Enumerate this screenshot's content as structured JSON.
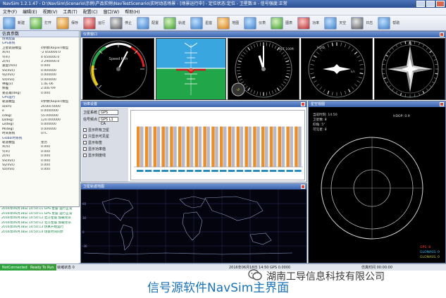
{
  "window": {
    "title": "NavSim 1.2.1.47 - D:\\NavSim\\Scenario\\示例\\产品实例\\NavTestScenario\\实时动态场景 - [场景运行中] - 定位状态:定位 - 卫星数:8 - 信号强度:正常",
    "controls": [
      "minimize-icon",
      "maximize-icon",
      "close-icon"
    ]
  },
  "menu": {
    "items": [
      "文件(F)",
      "编辑(E)",
      "视图(V)",
      "工具(T)",
      "配置(C)",
      "窗口(W)",
      "帮助(H)"
    ]
  },
  "toolbar": {
    "buttons": [
      {
        "label": "新建",
        "icon": "new-icon"
      },
      {
        "label": "打开",
        "icon": "open-icon"
      },
      {
        "label": "保存",
        "icon": "save-icon"
      },
      {
        "label": "运行",
        "icon": "play-icon"
      },
      {
        "label": "停止",
        "icon": "stop-icon"
      },
      {
        "label": "配置",
        "icon": "config-icon"
      },
      {
        "label": "轨迹",
        "icon": "track-icon"
      },
      {
        "label": "星座",
        "icon": "constellation-icon"
      },
      {
        "label": "地图",
        "icon": "map-icon"
      },
      {
        "label": "仪表",
        "icon": "gauge-icon"
      },
      {
        "label": "图表",
        "icon": "chart-icon"
      },
      {
        "label": "功率",
        "icon": "power-icon"
      },
      {
        "label": "天空",
        "icon": "sky-icon"
      },
      {
        "label": "日志",
        "icon": "log-icon"
      },
      {
        "label": "帮助",
        "icon": "help-icon"
      }
    ]
  },
  "left_panel": {
    "header": "仿真参数",
    "rows": [
      {
        "k": "仿真配置",
        "v": ""
      },
      {
        "k": "  GPS系统",
        "v": ""
      },
      {
        "k": "  卫星轨道模型",
        "v": "4参数(Kepler)模型"
      },
      {
        "k": "  X(m)",
        "v": "-2 850000.0"
      },
      {
        "k": "  Y(m)",
        "v": "4 650000.0"
      },
      {
        "k": "  Z(m)",
        "v": "3 290000.0"
      },
      {
        "k": "  速度(m/s)",
        "v": "0.000"
      },
      {
        "k": "  Vx(m/s)",
        "v": "0.000000"
      },
      {
        "k": "  Vy(m/s)",
        "v": "0.000000"
      },
      {
        "k": "  Vz(m/s)",
        "v": "0.000000"
      },
      {
        "k": "  钟差(s)",
        "v": "1.0E-06"
      },
      {
        "k": "  频差",
        "v": "2.00E-09"
      },
      {
        "k": "  姿态角(deg)",
        "v": "0.000"
      },
      {
        "k": "  GPS运行",
        "v": ""
      },
      {
        "k": "  轨道模型",
        "v": "4参数(Kepler)模型"
      },
      {
        "k": "  a(km)",
        "v": "26560.0000"
      },
      {
        "k": "  e",
        "v": "0.0000000"
      },
      {
        "k": "  i(deg)",
        "v": "55.000000"
      },
      {
        "k": "  Ω(deg)",
        "v": "120.000000"
      },
      {
        "k": "  ω(deg)",
        "v": "0.000000"
      },
      {
        "k": "  M(deg)",
        "v": "0.000000"
      },
      {
        "k": "  时间系统",
        "v": "UTC"
      },
      {
        "k": "  Global时系统",
        "v": ""
      },
      {
        "k": "  轨道模型",
        "v": "星历"
      },
      {
        "k": "  X(m)",
        "v": "0.000"
      },
      {
        "k": "  Y(m)",
        "v": "0.000"
      },
      {
        "k": "  Z(m)",
        "v": "0.000"
      },
      {
        "k": "  Vx(m/s)",
        "v": "0.000"
      },
      {
        "k": "  Vy(m/s)",
        "v": "0.000"
      },
      {
        "k": "  Vz(m/s)",
        "v": "0.000"
      }
    ]
  },
  "log": {
    "rows": [
      "2016年06月18日 14:50:11 GPS 星座 运行正常",
      "2016年06月18日 14:50:11 GPS 星座 运行正常",
      "2016年06月18日 14:50:12 北斗星座 加载完毕",
      "2016年06月18日 14:50:12 北斗星座 加载完毕",
      "2016年06月18日 14:50:13 仿真开始运行",
      "2016年06月18日 14:50:14 场景时间同步"
    ]
  },
  "status_bar": {
    "left": "NotConnected",
    "middle": "Ready To Run",
    "middle2": "就绪状态 0",
    "right": "2016年06月18日 14:50  GPS 0.0000",
    "right2": "仿真时间 00:00:00"
  },
  "windows": {
    "instruments": {
      "title": "仪表窗口"
    },
    "power": {
      "title": "功率设置"
    },
    "sky": {
      "title": "星空视图"
    },
    "map": {
      "title": "卫星轨迹地图"
    }
  },
  "instruments": {
    "airspeed": {
      "label": "Speed Knh"
    },
    "altimeter": {
      "label": "ALT 100ft"
    },
    "heading": {
      "label": "HDG"
    },
    "compass": {
      "label": "N"
    }
  },
  "power_panel": {
    "field1_label": "卫星系统",
    "field1_value": "GPS",
    "field2_label": "信号频点",
    "field2_value": "GPS L1 CA",
    "checks": [
      "显示所有卫星",
      "只显示可见星",
      "显示标签",
      "显示功率值",
      "显示刻度线"
    ],
    "bar_count": 20,
    "bars_level": 0.82
  },
  "sky_panel": {
    "text1": "当前时刻: 14:50",
    "text2": "卫星数: 8",
    "text3": "仰角: 5°",
    "text4": "可见星: 8",
    "mode": "HDOP: 0.9",
    "stats": [
      "GPS: 8",
      "GLONASS: 0",
      "GLONASS: 0"
    ]
  },
  "caption": {
    "text": "信号源软件NavSim主界面",
    "watermark": "湖南工导信息科技有限公司"
  }
}
